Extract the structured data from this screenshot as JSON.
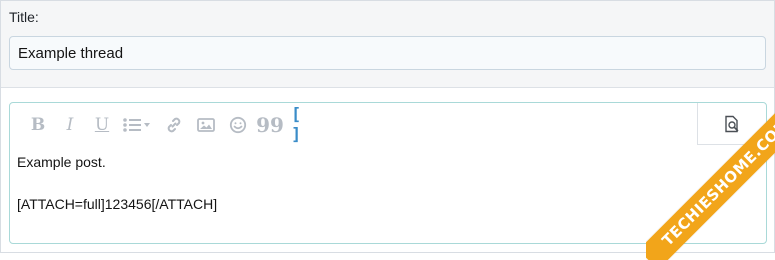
{
  "form": {
    "title_label": "Title:",
    "title_value": "Example thread"
  },
  "editor": {
    "toolbar": {
      "bold_label": "B",
      "italic_label": "I",
      "underline_label": "U",
      "quote_label": "99",
      "code_label": "[ ]",
      "icons": [
        "bold-icon",
        "italic-icon",
        "underline-icon",
        "list-icon",
        "link-icon",
        "image-icon",
        "smilie-icon",
        "quote-icon",
        "code-icon",
        "preview-icon"
      ]
    },
    "content": {
      "line1": "Example post.",
      "line2": "[ATTACH=full]123456[/ATTACH]"
    }
  },
  "watermark": {
    "text": "TECHIESHOME.COM"
  },
  "colors": {
    "accent_border": "#a9d9d8",
    "toolbar_inactive": "#b6bcc4",
    "code_active": "#3a8cc8",
    "watermark_bg": "#f2a51a"
  }
}
